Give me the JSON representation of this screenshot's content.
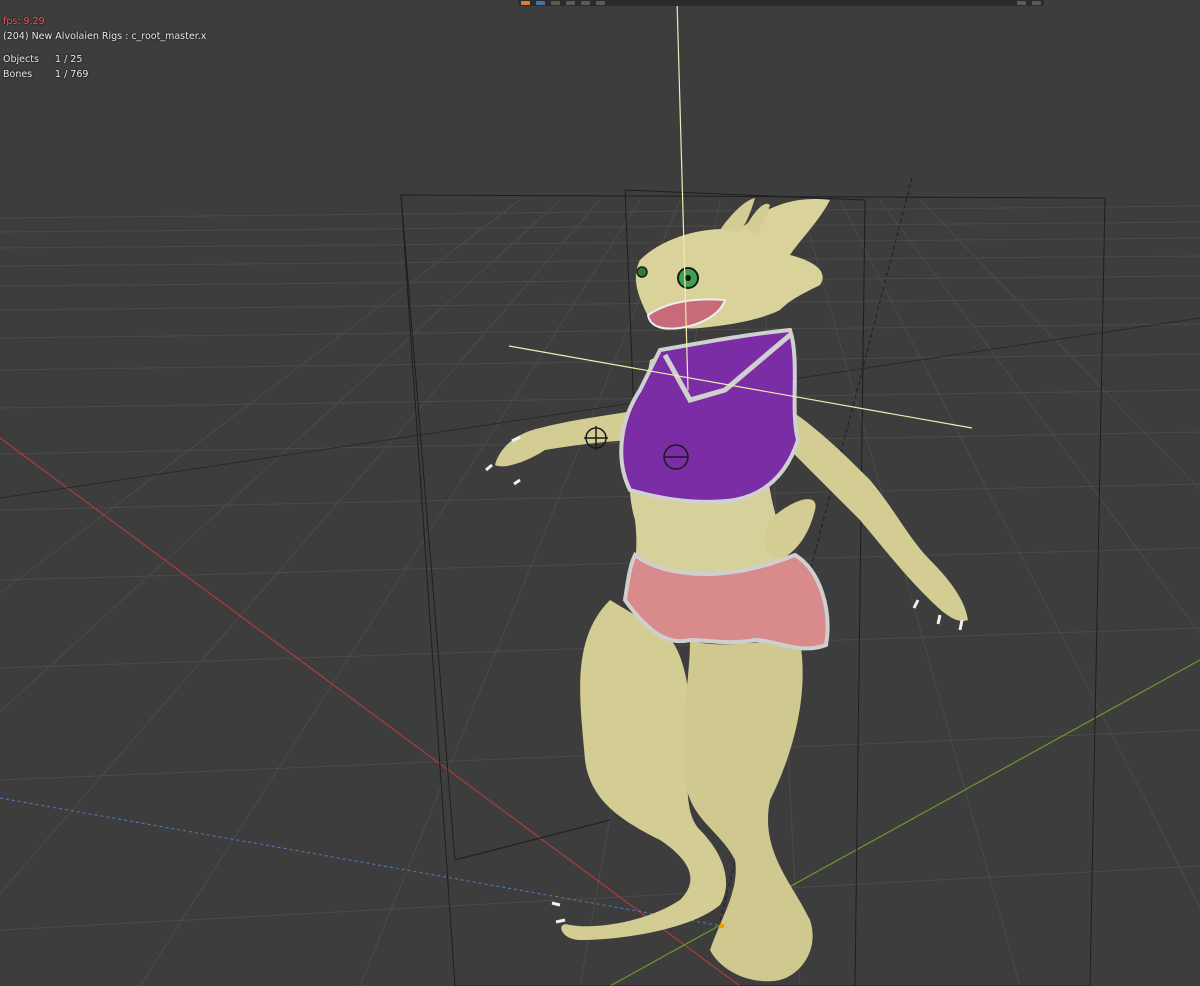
{
  "overlay": {
    "fps": "fps: 9.29",
    "object_info": "(204) New Alvolaien Rigs : c_root_master.x",
    "stats": [
      {
        "label": "Objects",
        "value": "1 / 25"
      },
      {
        "label": "Bones",
        "value": "1 / 769"
      }
    ]
  },
  "colors": {
    "background": "#3d3d3d",
    "grid": "#4a4a4a",
    "x_axis": "#c43b3b",
    "y_axis": "#6b9e2a",
    "skin": "#d6d19a",
    "top": "#7b2fa8",
    "shorts": "#d88a8a",
    "trim": "#c9c9c9",
    "eye": "#3fa34d",
    "bone_line": "#f3eab0"
  },
  "icons": [
    "object-mode-icon",
    "viewport-shading-icons",
    "overlay-icon"
  ]
}
